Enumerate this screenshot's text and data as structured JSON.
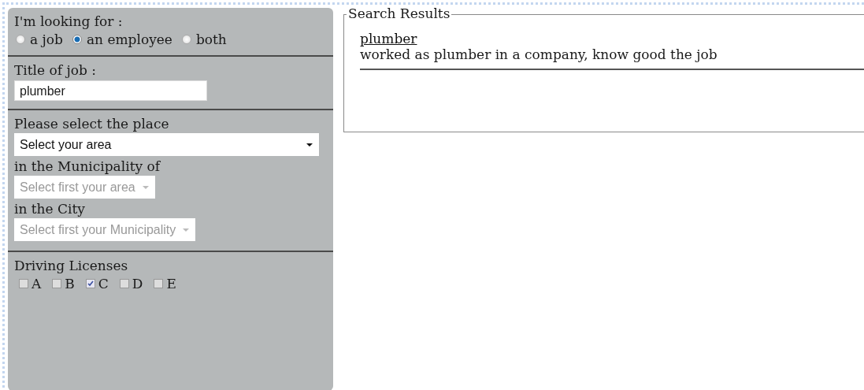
{
  "search_form": {
    "looking_for": {
      "label": "I'm looking for :",
      "options": [
        {
          "label": "a job",
          "selected": false
        },
        {
          "label": "an employee",
          "selected": true
        },
        {
          "label": "both",
          "selected": false
        }
      ]
    },
    "job_title": {
      "label": "Title of job :",
      "value": "plumber"
    },
    "place": {
      "label": "Please select the place",
      "selects": [
        {
          "value": "Select your area",
          "disabled": false
        },
        {
          "label": "in the Municipality of",
          "value": "Select first your area",
          "disabled": true
        },
        {
          "label": "in the City",
          "value": "Select first your Municipality",
          "disabled": true
        }
      ]
    },
    "licenses": {
      "label": "Driving Licenses",
      "options": [
        {
          "label": "A",
          "checked": false
        },
        {
          "label": "B",
          "checked": false
        },
        {
          "label": "C",
          "checked": true
        },
        {
          "label": "D",
          "checked": false
        },
        {
          "label": "E",
          "checked": false
        }
      ]
    }
  },
  "search_results": {
    "title": "Search Results",
    "results": [
      {
        "title": "plumber",
        "description": "worked as plumber in a company, know good the job"
      }
    ]
  }
}
